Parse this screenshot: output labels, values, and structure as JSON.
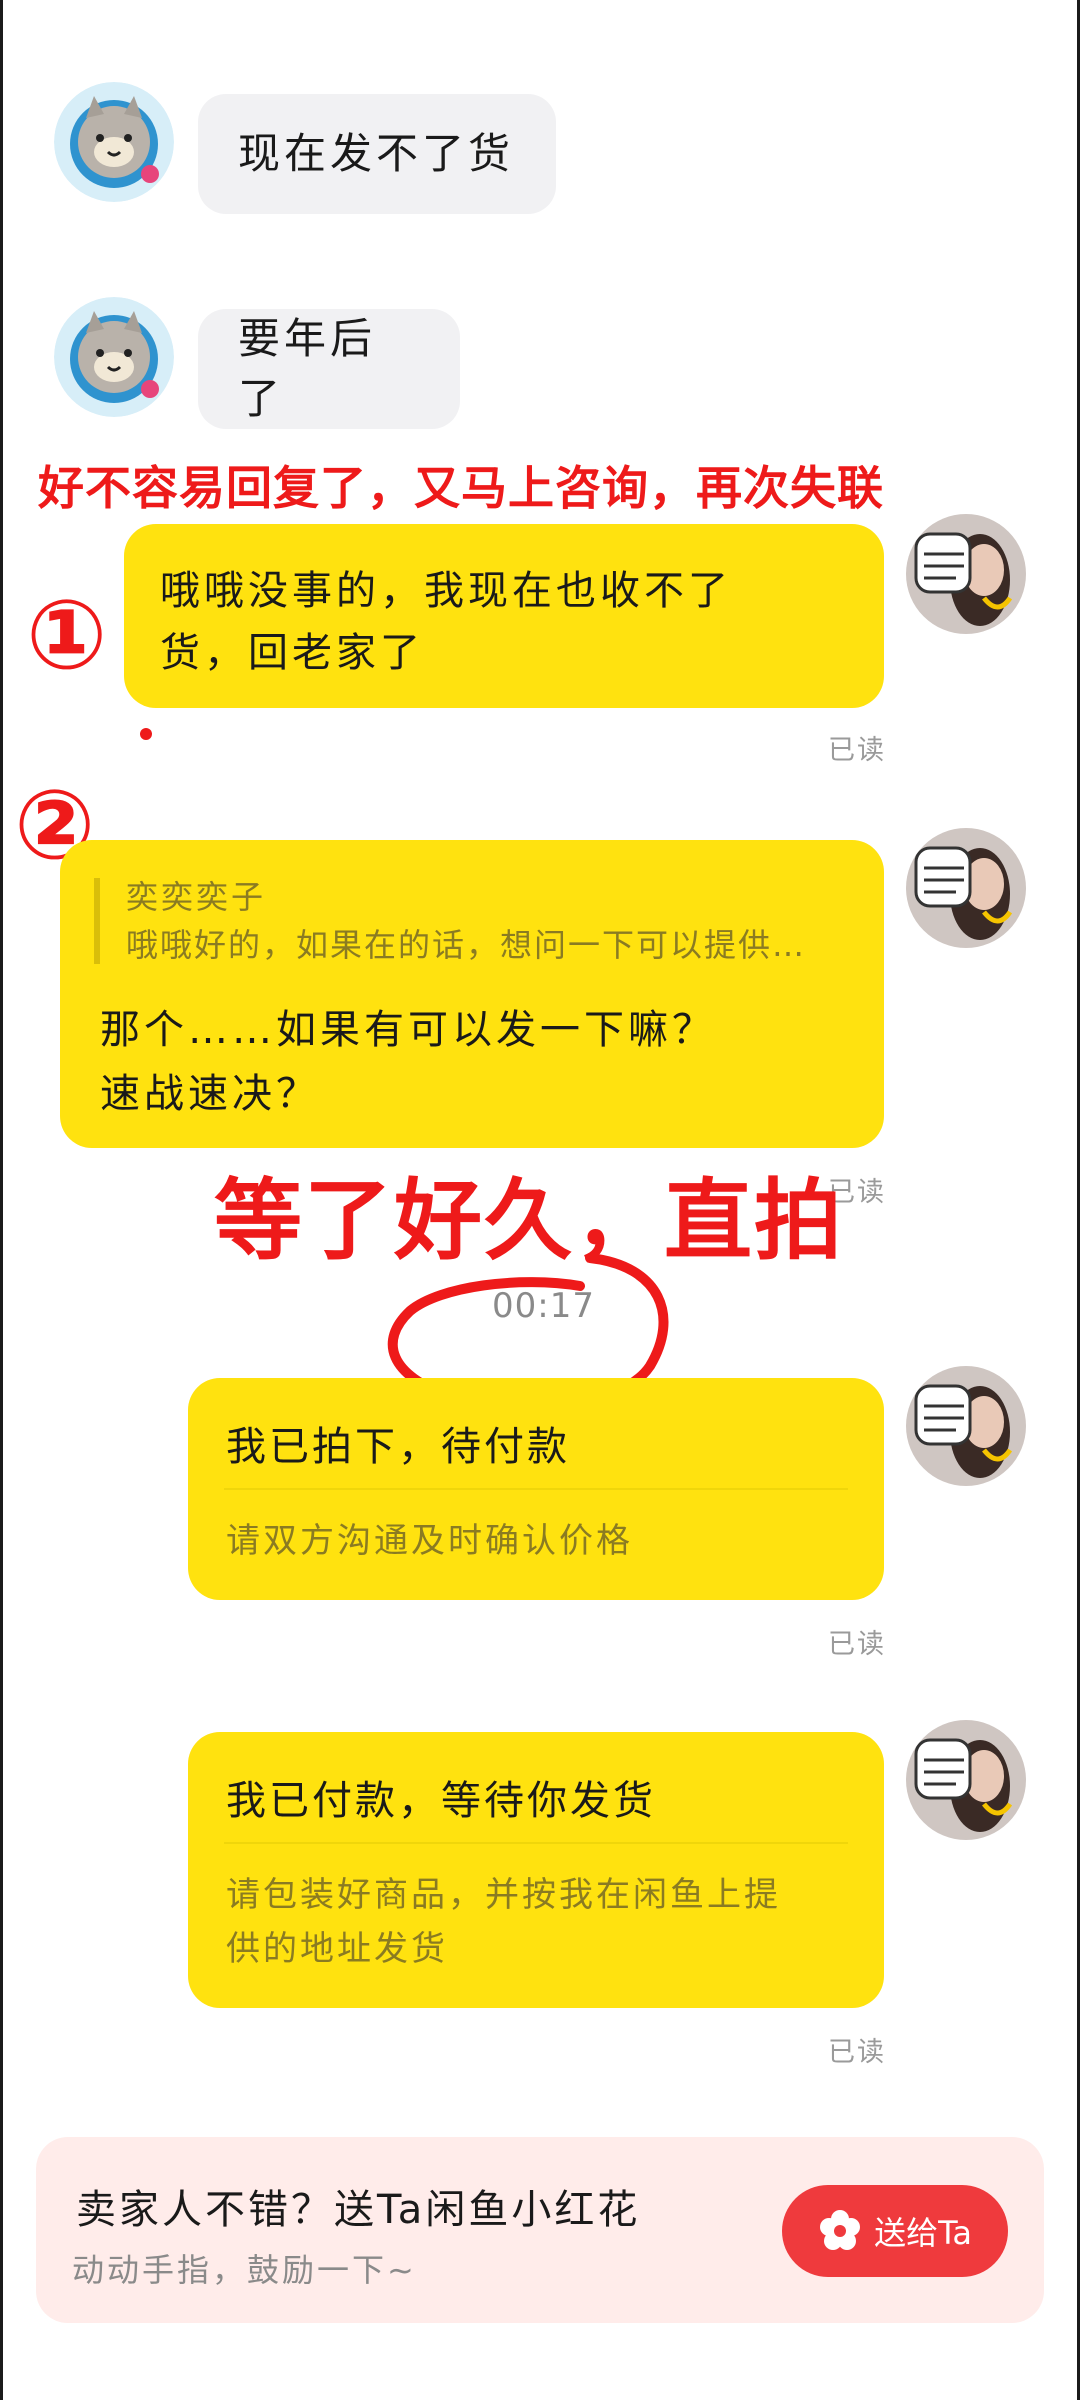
{
  "messages_in": [
    {
      "text": "现在发不了货"
    },
    {
      "text": "要年后了"
    }
  ],
  "annotations": {
    "banner": "好不容易回复了，又马上咨询，再次失联",
    "marker_1": "①",
    "marker_2": "②",
    "wait_note": "等了好久，直拍"
  },
  "messages_out": [
    {
      "text_line1": "哦哦没事的，我现在也收不了",
      "text_line2": "货，回老家了",
      "status": "已读"
    },
    {
      "quote_author": "奕奕奕子",
      "quote_text": "哦哦好的，如果在的话，想问一下可以提供…",
      "text_line1": "那个……如果有可以发一下嘛？",
      "text_line2": "速战速决？",
      "status": "已读"
    }
  ],
  "timestamp": "00:17",
  "order_cards": [
    {
      "title": "我已拍下，待付款",
      "desc": "请双方沟通及时确认价格",
      "status": "已读"
    },
    {
      "title": "我已付款，等待你发货",
      "desc_line1": "请包装好商品，并按我在闲鱼上提",
      "desc_line2": "供的地址发货",
      "status": "已读"
    }
  ],
  "promo": {
    "title": "卖家人不错？送Ta闲鱼小红花",
    "subtitle": "动动手指，鼓励一下~",
    "button_label": "送给Ta",
    "button_color": "#ef3a3d",
    "background": "#ffecea"
  },
  "colors": {
    "bubble_out": "#ffe20f",
    "bubble_in": "#f1f1f3",
    "annotation_red": "#ee1a1a"
  },
  "icons": {
    "seller_avatar": "cat-avatar-icon",
    "buyer_avatar": "user-photo-avatar",
    "flower": "flower-icon"
  }
}
